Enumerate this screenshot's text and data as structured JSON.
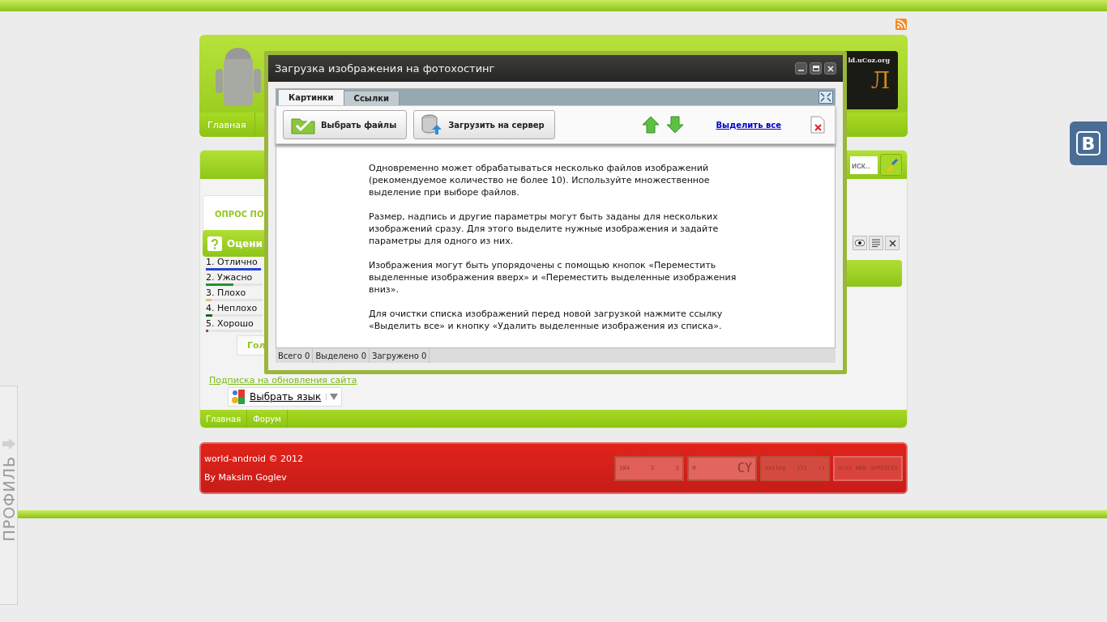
{
  "header": {
    "banner_site": "ld.uCoz.org",
    "banner_letter": "Л",
    "nav": [
      {
        "label": "Главная"
      }
    ]
  },
  "search": {
    "placeholder": "иск.."
  },
  "poll": {
    "tab": "ОПРОС ПО",
    "heading": "Оцени",
    "vote_button": "Гол",
    "options": [
      {
        "label": "1. Отлично",
        "level": 0.97,
        "color": "#2548d6"
      },
      {
        "label": "2. Ужасно",
        "level": 0.49,
        "color": "#22942c"
      },
      {
        "label": "3. Плохо",
        "level": 0.1,
        "color": "#e2c27a"
      },
      {
        "label": "4. Неплохо",
        "level": 0.11,
        "color": "#17652a"
      },
      {
        "label": "5. Хорошо",
        "level": 0.04,
        "color": "#9a4a4a"
      }
    ]
  },
  "subscribe_link": "Подписка на обновления сайта",
  "translate": {
    "label": "Выбрать язык"
  },
  "bottom_nav": [
    {
      "label": "Главная"
    },
    {
      "label": "Форум"
    }
  ],
  "footer": {
    "copyright": "world-android © 2012",
    "author": "By Maksim Goglev",
    "counters": [
      {
        "kind": "stats",
        "texts": [
          "104",
          "2",
          "1"
        ]
      },
      {
        "kind": "yandex",
        "texts": [
          "Я",
          "CY"
        ]
      },
      {
        "kind": "hotlog",
        "texts": [
          "hotlog",
          "171",
          "+1"
        ]
      },
      {
        "kind": "ucoz",
        "texts": [
          "ucoz",
          "WEB",
          "SERVICES"
        ]
      }
    ]
  },
  "side_tab": {
    "label": "ПРОФИЛЬ"
  },
  "vk_button": {
    "label": "В"
  },
  "dialog": {
    "title": "Загрузка изображения на фотохостинг",
    "tabs": [
      {
        "label": "Картинки",
        "selected": true
      },
      {
        "label": "Ссылки",
        "selected": false
      }
    ],
    "buttons": [
      {
        "kind": "choose",
        "label": "Выбрать файлы"
      },
      {
        "kind": "upload",
        "label": "Загрузить на сервер"
      }
    ],
    "select_all": "Выделить все",
    "paragraphs": [
      "Одновременно может обрабатываться несколько файлов изображений (рекомендуемое количество не более 10). Используйте множественное выделение при выборе файлов.",
      "Размер, надпись и другие параметры могут быть заданы для нескольких изображений сразу. Для этого выделите нужные изображения и задайте параметры для одного из них.",
      "Изображения могут быть упорядочены с помощью кнопок «Переместить выделенные изображения вверх» и «Переместить выделенные изображения вниз».",
      "Для очистки списка изображений перед новой загрузкой нажмите ссылку «Выделить все» и кнопку «Удалить выделенные изображения из списка»."
    ],
    "status": [
      "Всего 0",
      "Выделено 0",
      "Загружено 0"
    ]
  }
}
